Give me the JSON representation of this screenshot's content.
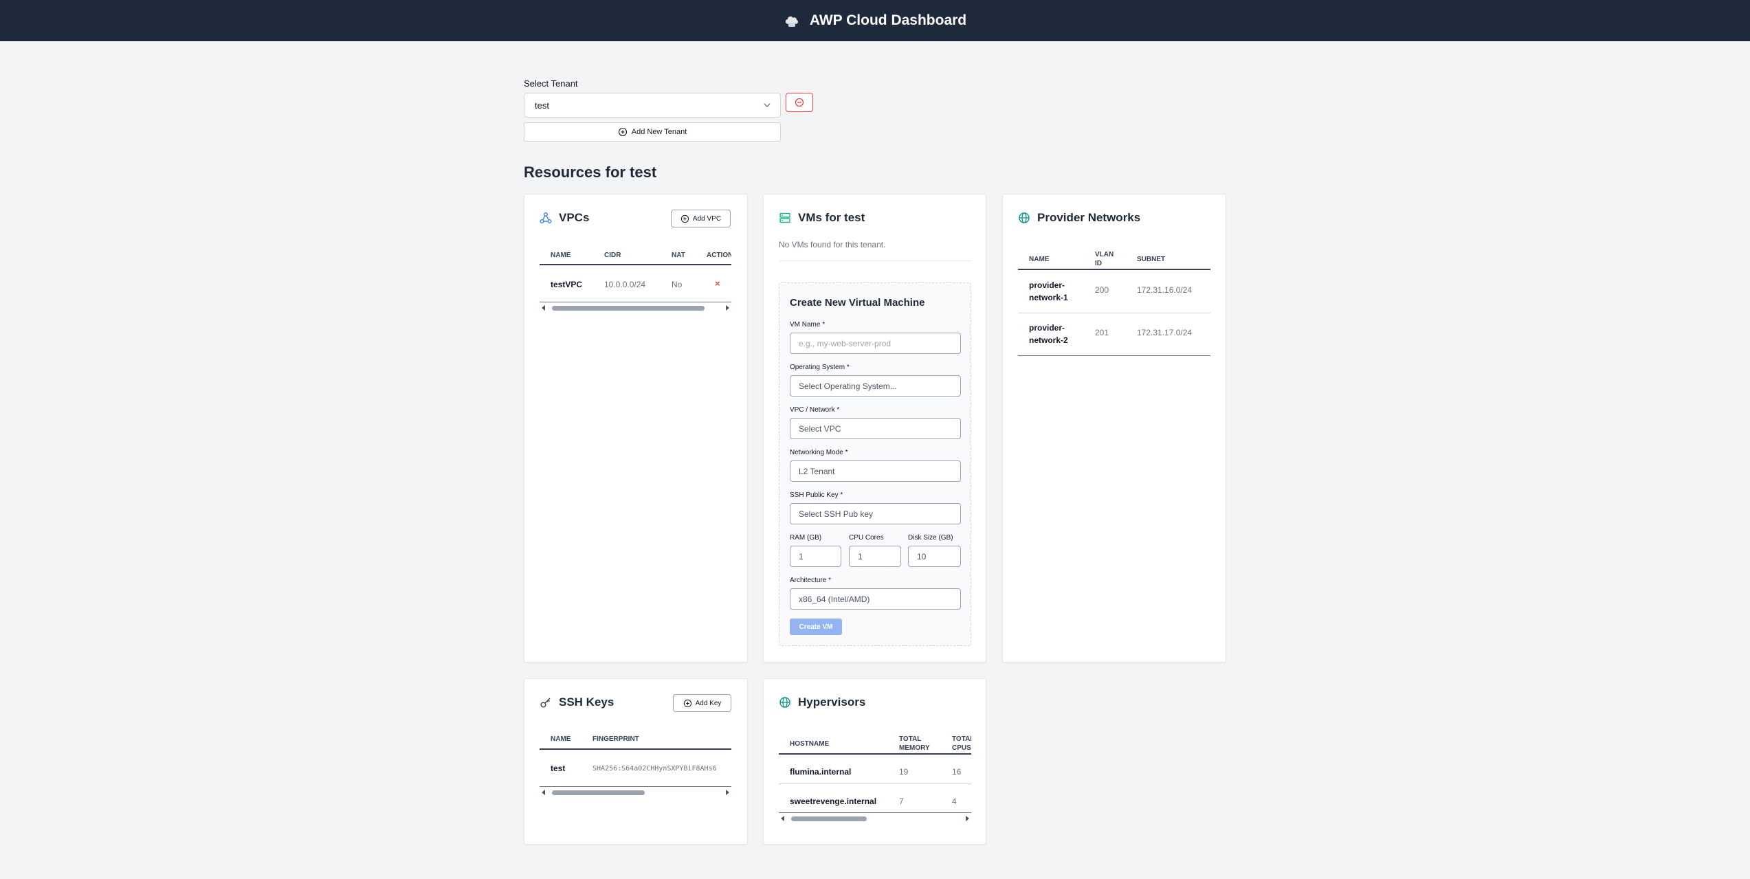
{
  "header": {
    "title": "AWP Cloud Dashboard",
    "logo_icon": "cloud-icon"
  },
  "tenant": {
    "label": "Select Tenant",
    "selected": "test",
    "add_button": "Add New Tenant"
  },
  "resources_title": "Resources for test",
  "vpcs": {
    "title": "VPCs",
    "add_button": "Add VPC",
    "columns": [
      "NAME",
      "CIDR",
      "NAT",
      "ACTIONS"
    ],
    "rows": [
      {
        "name": "testVPC",
        "cidr": "10.0.0.0/24",
        "nat": "No",
        "action": "×"
      }
    ]
  },
  "vms": {
    "title": "VMs for test",
    "empty_text": "No VMs found for this tenant.",
    "form": {
      "title": "Create New Virtual Machine",
      "vm_name_label": "VM Name *",
      "vm_name_placeholder": "e.g., my-web-server-prod",
      "os_label": "Operating System *",
      "os_value": "Select Operating System...",
      "vpc_label": "VPC / Network *",
      "vpc_value": "Select VPC",
      "netmode_label": "Networking Mode *",
      "netmode_value": "L2 Tenant",
      "ssh_label": "SSH Public Key *",
      "ssh_value": "Select SSH Pub key",
      "ram_label": "RAM (GB)",
      "ram_value": "1",
      "cpu_label": "CPU Cores",
      "cpu_value": "1",
      "disk_label": "Disk Size (GB)",
      "disk_value": "10",
      "arch_label": "Architecture *",
      "arch_value": "x86_64 (Intel/AMD)",
      "create_button": "Create VM"
    }
  },
  "provider_networks": {
    "title": "Provider Networks",
    "columns": [
      "NAME",
      "VLAN ID",
      "SUBNET"
    ],
    "rows": [
      {
        "name": "provider-network-1",
        "vlan": "200",
        "subnet": "172.31.16.0/24"
      },
      {
        "name": "provider-network-2",
        "vlan": "201",
        "subnet": "172.31.17.0/24"
      }
    ]
  },
  "ssh_keys": {
    "title": "SSH Keys",
    "add_button": "Add Key",
    "columns": [
      "NAME",
      "FINGERPRINT"
    ],
    "rows": [
      {
        "name": "test",
        "fingerprint": "SHA256:S64a02CHHynSXPYBiF8AHs6"
      }
    ]
  },
  "hypervisors": {
    "title": "Hypervisors",
    "columns": [
      "HOSTNAME",
      "TOTAL MEMORY",
      "TOTAL CPUS"
    ],
    "rows": [
      {
        "hostname": "flumina.internal",
        "memory": "19",
        "cpus": "16"
      },
      {
        "hostname": "sweetrevenge.internal",
        "memory": "7",
        "cpus": "4"
      }
    ]
  },
  "colors": {
    "topbar": "#1e293b",
    "vpc_icon": "#3b82f6",
    "vm_icon": "#10b981",
    "net_icon": "#0d9488",
    "danger": "#ef4444",
    "create_button": "#93b4f0"
  }
}
